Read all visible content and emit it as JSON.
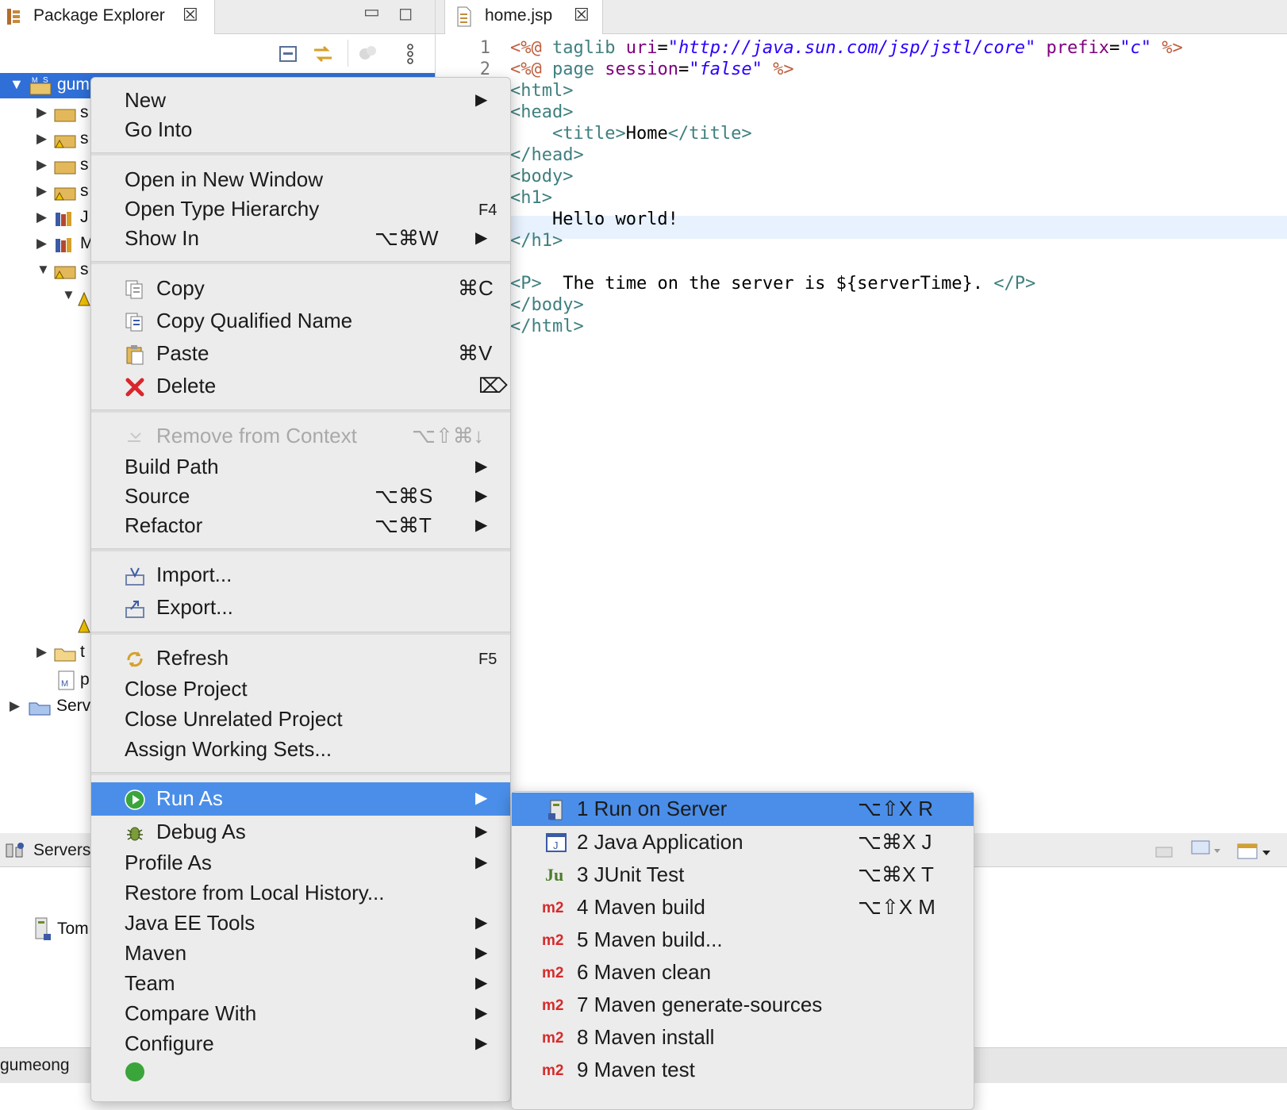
{
  "package_explorer": {
    "tab_label": "Package Explorer",
    "project_name": "gum",
    "tree_partial_labels": [
      "s",
      "s",
      "s",
      "s",
      "J",
      "M",
      "s",
      "t",
      "p"
    ],
    "servers_node": "Serv"
  },
  "editor": {
    "tab_label": "home.jsp",
    "line_numbers": [
      "1",
      "2"
    ],
    "lines": {
      "l1_a": "<%@",
      "l1_b": " taglib ",
      "l1_c": "uri",
      "l1_d": "=",
      "l1_e": "\"http://java.sun.com/jsp/jstl/core\"",
      "l1_f": " prefix",
      "l1_g": "=",
      "l1_h": "\"c\"",
      "l1_i": " %>",
      "l2_a": "<%@",
      "l2_b": " page ",
      "l2_c": "session",
      "l2_d": "=",
      "l2_e": "\"false\"",
      "l2_f": " %>",
      "l3": "<html>",
      "l4": "<head>",
      "l5_a": "    <title>",
      "l5_b": "Home",
      "l5_c": "</title>",
      "l6": "</head>",
      "l7": "<body>",
      "l8": "<h1>",
      "l9": "    Hello world!",
      "l10": "</h1>",
      "l12_a": "<P>",
      "l12_b": "  The time on the server is ${serverTime}. ",
      "l12_c": "</P>",
      "l13": "</body>",
      "l14": "</html>"
    }
  },
  "servers_panel": {
    "tab_label": "Servers",
    "server_item": "Tom"
  },
  "status_bar": {
    "text": "gumeong"
  },
  "context_menu": {
    "new": "New",
    "go_into": "Go Into",
    "open_new_window": "Open in New Window",
    "open_type_hierarchy": "Open Type Hierarchy",
    "open_type_hierarchy_sc": "F4",
    "show_in": "Show In",
    "show_in_sc": "⌥⌘W",
    "copy": "Copy",
    "copy_sc": "⌘C",
    "copy_qualified": "Copy Qualified Name",
    "paste": "Paste",
    "paste_sc": "⌘V",
    "delete": "Delete",
    "delete_sc": "⌦",
    "remove_context": "Remove from Context",
    "remove_context_sc": "⌥⇧⌘↓",
    "build_path": "Build Path",
    "source": "Source",
    "source_sc": "⌥⌘S",
    "refactor": "Refactor",
    "refactor_sc": "⌥⌘T",
    "import": "Import...",
    "export": "Export...",
    "refresh": "Refresh",
    "refresh_sc": "F5",
    "close_project": "Close Project",
    "close_unrelated": "Close Unrelated Project",
    "assign_working_sets": "Assign Working Sets...",
    "run_as": "Run As",
    "debug_as": "Debug As",
    "profile_as": "Profile As",
    "restore_history": "Restore from Local History...",
    "java_ee_tools": "Java EE Tools",
    "maven": "Maven",
    "team": "Team",
    "compare_with": "Compare With",
    "configure": "Configure"
  },
  "run_as_submenu": {
    "items": [
      {
        "label": "1 Run on Server",
        "shortcut": "⌥⇧X R"
      },
      {
        "label": "2 Java Application",
        "shortcut": "⌥⌘X J"
      },
      {
        "label": "3 JUnit Test",
        "shortcut": "⌥⌘X T"
      },
      {
        "label": "4 Maven build",
        "shortcut": "⌥⇧X M"
      },
      {
        "label": "5 Maven build...",
        "shortcut": ""
      },
      {
        "label": "6 Maven clean",
        "shortcut": ""
      },
      {
        "label": "7 Maven generate-sources",
        "shortcut": ""
      },
      {
        "label": "8 Maven install",
        "shortcut": ""
      },
      {
        "label": "9 Maven test",
        "shortcut": ""
      }
    ],
    "m2_badge": "m2",
    "junit_badge": "Ju"
  },
  "colors": {
    "selection": "#4a8ee9",
    "menu_bg": "#ececec",
    "jsp_tag": "#3f7f7f",
    "jsp_directive": "#bf5f3f",
    "jsp_attr": "#7f007f",
    "jsp_string": "#2a00ff",
    "current_line": "#e8f2fe"
  }
}
